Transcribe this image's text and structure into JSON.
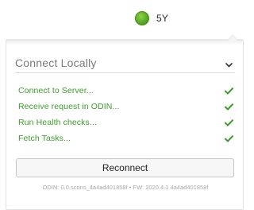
{
  "status": {
    "dot_color": "#5aa923",
    "label": "5Y"
  },
  "panel": {
    "section_title": "Connect Locally",
    "chevron_icon": "chevron-down-icon",
    "check_color": "#3b9c2a",
    "steps": [
      {
        "label": "Connect to Server...",
        "icon": "check-icon"
      },
      {
        "label": "Receive request in ODIN...",
        "icon": "check-icon"
      },
      {
        "label": "Run Health checks...",
        "icon": "check-icon"
      },
      {
        "label": "Fetch Tasks...",
        "icon": "check-icon"
      }
    ],
    "reconnect_label": "Reconnect",
    "footer": "ODIN: 0.0.scons_4a4ad401858f • FW: 2020.4.1 4a4ad401858f"
  }
}
